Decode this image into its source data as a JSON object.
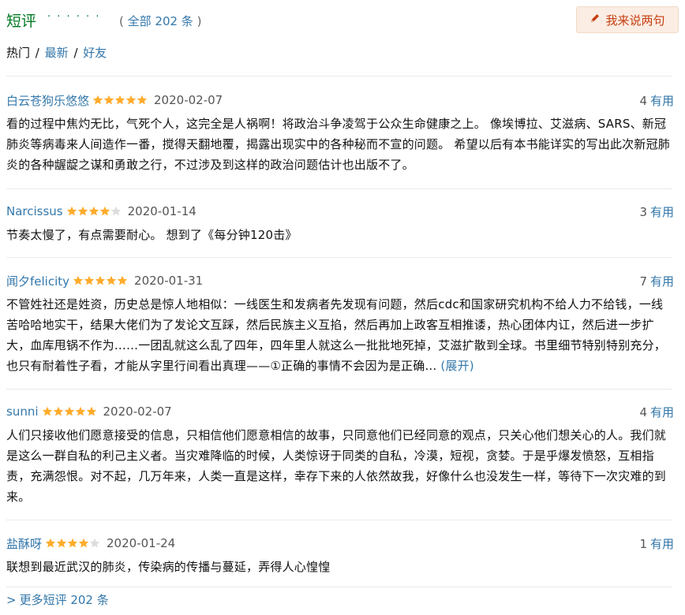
{
  "header": {
    "title": "短评",
    "dots": "· · · · · ·",
    "count_open": "(",
    "count_text": "全部 202 条",
    "count_close": ")",
    "write_button": "我来说两句"
  },
  "tabs": {
    "hot": "热门",
    "sep": "/",
    "latest": "最新",
    "friends": "好友"
  },
  "colors": {
    "link": "#3377aa",
    "star": "#ffac2d",
    "star_empty": "#dddddd",
    "button_bg": "#fbede3",
    "button_text": "#c53f10"
  },
  "comments": [
    {
      "user": "白云苍狗乐悠悠",
      "rating": 5,
      "date": "2020-02-07",
      "votes": "4",
      "votes_label": "有用",
      "text": "看的过程中焦灼无比，气死个人，这完全是人祸啊！将政治斗争凌驾于公众生命健康之上。 像埃博拉、艾滋病、SARS、新冠肺炎等病毒来人间造作一番，搅得天翻地覆，揭露出现实中的各种秘而不宣的问题。 希望以后有本书能详实的写出此次新冠肺炎的各种龌龊之谋和勇敢之行，不过涉及到这样的政治问题估计也出版不了。",
      "expand": ""
    },
    {
      "user": "Narcissus",
      "rating": 4,
      "date": "2020-01-14",
      "votes": "3",
      "votes_label": "有用",
      "text": "节奏太慢了，有点需要耐心。 想到了《每分钟120击》",
      "expand": ""
    },
    {
      "user": "闻夕felicity",
      "rating": 5,
      "date": "2020-01-31",
      "votes": "7",
      "votes_label": "有用",
      "text": "不管姓社还是姓资，历史总是惊人地相似：一线医生和发病者先发现有问题，然后cdc和国家研究机构不给人力不给钱，一线苦哈哈地实干，结果大佬们为了发论文互踩，然后民族主义互掐，然后再加上政客互相推诿，热心团体内讧，然后进一步扩大，血库甩锅不作为……一团乱就这么乱了四年，四年里人就这么一批批地死掉，艾滋扩散到全球。书里细节特别特别充分，也只有耐着性子看，才能从字里行间看出真理——①正确的事情不会因为是正确...",
      "expand": "(展开)"
    },
    {
      "user": "sunni",
      "rating": 5,
      "date": "2020-02-07",
      "votes": "4",
      "votes_label": "有用",
      "text": "人们只接收他们愿意接受的信息，只相信他们愿意相信的故事，只同意他们已经同意的观点，只关心他们想关心的人。我们就是这么一群自私的利己主义者。当灾难降临的时候，人类惊讶于同类的自私，冷漠，短视，贪婪。于是乎爆发愤怒，互相指责，充满怨恨。对不起，几万年来，人类一直是这样，幸存下来的人依然故我，好像什么也没发生一样，等待下一次灾难的到来。",
      "expand": ""
    },
    {
      "user": "盐酥呀",
      "rating": 4,
      "date": "2020-01-24",
      "votes": "1",
      "votes_label": "有用",
      "text": "联想到最近武汉的肺炎，传染病的传播与蔓延，弄得人心惶惶",
      "expand": ""
    }
  ],
  "more": {
    "arrow": ">",
    "label": "更多短评 202 条"
  }
}
